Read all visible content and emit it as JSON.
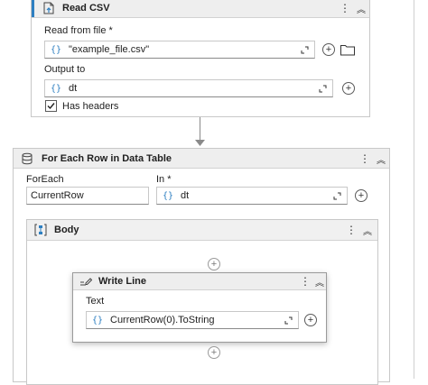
{
  "read_csv": {
    "title": "Read CSV",
    "icon": "csv-file-icon",
    "read_from_label": "Read from file *",
    "read_from_value": "\"example_file.csv\"",
    "output_label": "Output to",
    "output_value": "dt",
    "has_headers_label": "Has headers",
    "has_headers_checked": true
  },
  "for_each": {
    "title": "For Each Row in Data Table",
    "icon": "data-table-icon",
    "foreach_label": "ForEach",
    "foreach_value": "CurrentRow",
    "in_label": "In *",
    "in_value": "dt"
  },
  "body": {
    "title": "Body",
    "icon": "sequence-icon"
  },
  "write_line": {
    "title": "Write Line",
    "icon": "write-line-icon",
    "text_label": "Text",
    "text_value": "CurrentRow(0).ToString"
  },
  "glyphs": {
    "brace": "{}",
    "more": "⋮",
    "collapse": "︽",
    "plus": "+",
    "check": "✓"
  },
  "colors": {
    "accent": "#2d7fc1",
    "header_bg": "#eeeeee",
    "border": "#c8c8c8"
  }
}
